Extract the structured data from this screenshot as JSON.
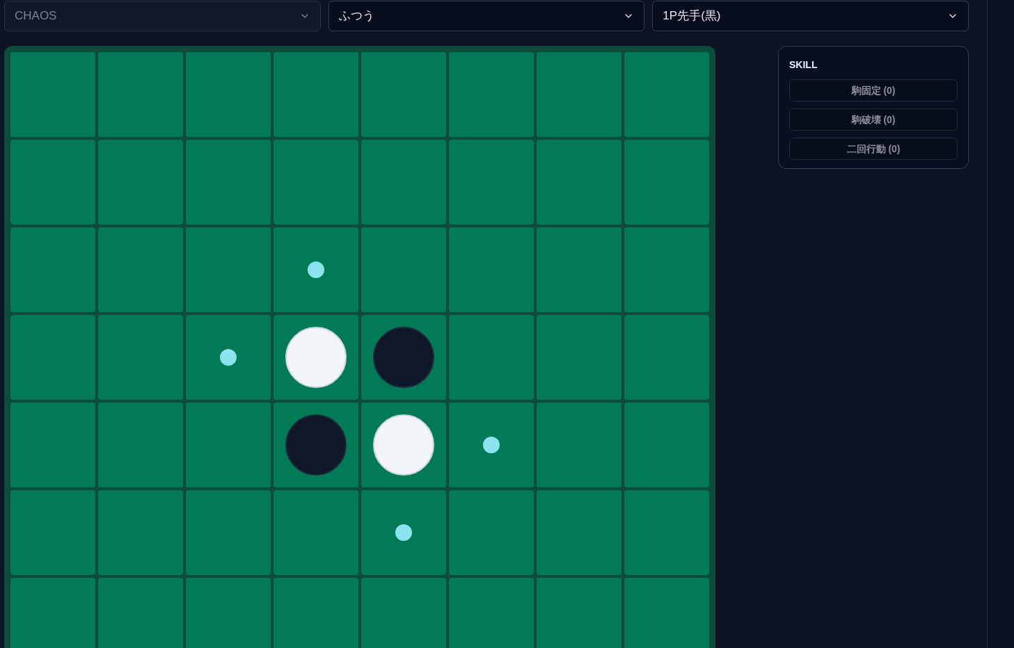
{
  "selects": [
    {
      "value": "CHAOS",
      "disabled": true
    },
    {
      "value": "ふつう",
      "disabled": false
    },
    {
      "value": "1P先手(黒)",
      "disabled": false
    }
  ],
  "board": {
    "rows": [
      {
        "cells": [
          {
            "kind": "empty"
          },
          {
            "kind": "empty"
          },
          {
            "kind": "empty"
          },
          {
            "kind": "empty"
          },
          {
            "kind": "empty"
          },
          {
            "kind": "empty"
          },
          {
            "kind": "empty"
          },
          {
            "kind": "empty"
          }
        ]
      },
      {
        "cells": [
          {
            "kind": "empty"
          },
          {
            "kind": "empty"
          },
          {
            "kind": "empty"
          },
          {
            "kind": "empty"
          },
          {
            "kind": "empty"
          },
          {
            "kind": "empty"
          },
          {
            "kind": "empty"
          },
          {
            "kind": "empty"
          }
        ]
      },
      {
        "cells": [
          {
            "kind": "empty"
          },
          {
            "kind": "empty"
          },
          {
            "kind": "empty"
          },
          {
            "kind": "hint"
          },
          {
            "kind": "empty"
          },
          {
            "kind": "empty"
          },
          {
            "kind": "empty"
          },
          {
            "kind": "empty"
          }
        ]
      },
      {
        "cells": [
          {
            "kind": "empty"
          },
          {
            "kind": "empty"
          },
          {
            "kind": "hint"
          },
          {
            "kind": "white"
          },
          {
            "kind": "black"
          },
          {
            "kind": "empty"
          },
          {
            "kind": "empty"
          },
          {
            "kind": "empty"
          }
        ]
      },
      {
        "cells": [
          {
            "kind": "empty"
          },
          {
            "kind": "empty"
          },
          {
            "kind": "empty"
          },
          {
            "kind": "black"
          },
          {
            "kind": "white"
          },
          {
            "kind": "hint"
          },
          {
            "kind": "empty"
          },
          {
            "kind": "empty"
          }
        ]
      },
      {
        "cells": [
          {
            "kind": "empty"
          },
          {
            "kind": "empty"
          },
          {
            "kind": "empty"
          },
          {
            "kind": "empty"
          },
          {
            "kind": "hint"
          },
          {
            "kind": "empty"
          },
          {
            "kind": "empty"
          },
          {
            "kind": "empty"
          }
        ]
      },
      {
        "cells": [
          {
            "kind": "empty"
          },
          {
            "kind": "empty"
          },
          {
            "kind": "empty"
          },
          {
            "kind": "empty"
          },
          {
            "kind": "empty"
          },
          {
            "kind": "empty"
          },
          {
            "kind": "empty"
          },
          {
            "kind": "empty"
          }
        ]
      }
    ]
  },
  "skill_panel": {
    "title": "SKILL",
    "buttons": [
      {
        "label": "駒固定 (0)",
        "disabled": true
      },
      {
        "label": "駒破壊 (0)",
        "disabled": true
      },
      {
        "label": "二回行動 (0)",
        "disabled": true
      }
    ]
  }
}
